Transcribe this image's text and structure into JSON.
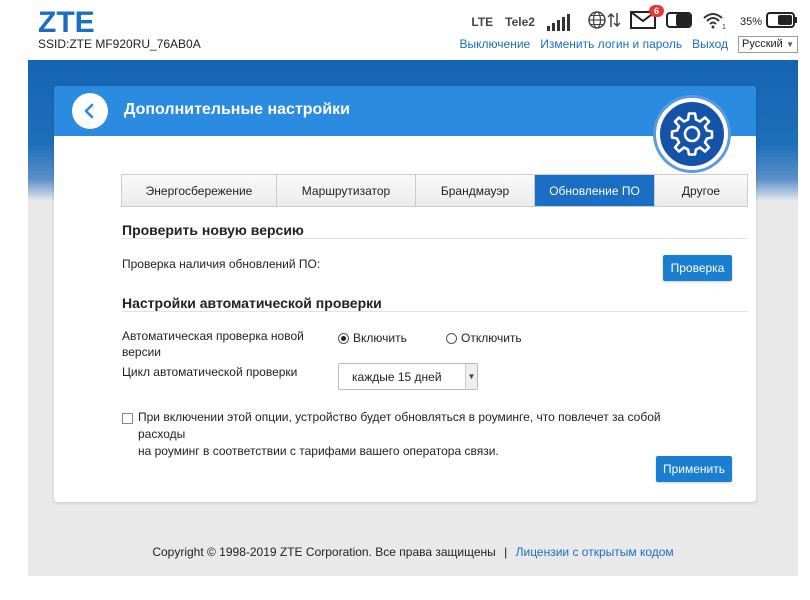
{
  "header": {
    "logo": "ZTE",
    "ssid": "SSID:ZTE MF920RU_76AB0A",
    "network_type": "LTE",
    "operator": "Tele2",
    "messages_badge": "6",
    "battery_percent": "35%",
    "links": {
      "logout": "Выключение",
      "change_login": "Изменить логин и пароль",
      "exit": "Выход"
    },
    "language": "Русский"
  },
  "card": {
    "title": "Дополнительные настройки",
    "tabs": [
      {
        "label": "Энергосбережение"
      },
      {
        "label": "Маршрутизатор"
      },
      {
        "label": "Брандмауэр"
      },
      {
        "label": "Обновление ПО"
      },
      {
        "label": "Другое"
      }
    ],
    "active_tab": "Обновление ПО",
    "check_section": {
      "title": "Проверить новую версию",
      "label": "Проверка наличия обновлений ПО:",
      "button": "Проверка"
    },
    "auto_section": {
      "title": "Настройки автоматической проверки",
      "auto_check_label_1": "Автоматическая проверка новой",
      "auto_check_label_2": "версии",
      "option_on": "Включить",
      "option_off": "Отключить",
      "selected_option": "Включить",
      "cycle_label": "Цикл автоматической проверки",
      "cycle_value": "каждые 15 дней"
    },
    "roaming": {
      "line1": "При включении этой опции, устройство будет обновляться в роуминге, что повлечет за собой расходы",
      "line2": "на роуминг в соответствии с тарифами вашего оператора связи.",
      "checked": false
    },
    "apply_button": "Применить"
  },
  "footer": {
    "copyright": "Copyright © 1998-2019 ZTE Corporation. Все права защищены",
    "separator": "|",
    "license_link": "Лицензии с открытым кодом"
  },
  "colors": {
    "brand_blue": "#1a6fc4",
    "header_band": "#1564b2",
    "card_header": "#2a8be0",
    "badge_red": "#e53935"
  }
}
